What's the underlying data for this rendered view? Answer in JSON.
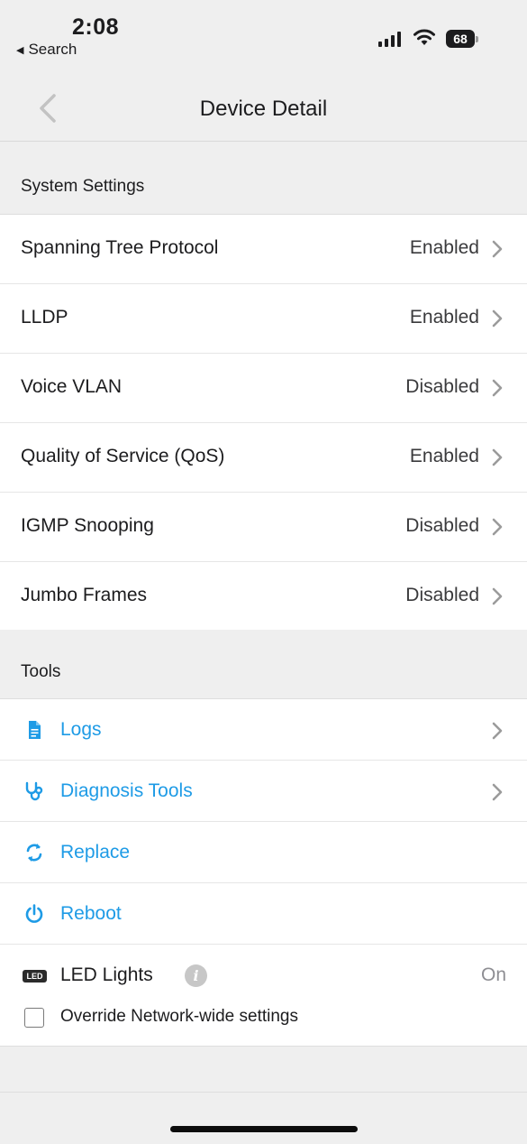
{
  "status_bar": {
    "time": "2:08",
    "back_app": "Search",
    "battery": "68"
  },
  "nav": {
    "title": "Device Detail"
  },
  "system_settings": {
    "header": "System Settings",
    "items": [
      {
        "label": "Spanning Tree Protocol",
        "value": "Enabled"
      },
      {
        "label": "LLDP",
        "value": "Enabled"
      },
      {
        "label": "Voice VLAN",
        "value": "Disabled"
      },
      {
        "label": "Quality of Service (QoS)",
        "value": "Enabled"
      },
      {
        "label": "IGMP Snooping",
        "value": "Disabled"
      },
      {
        "label": "Jumbo Frames",
        "value": "Disabled"
      }
    ]
  },
  "tools": {
    "header": "Tools",
    "items": [
      {
        "label": "Logs",
        "icon": "document-icon"
      },
      {
        "label": "Diagnosis Tools",
        "icon": "stethoscope-icon"
      },
      {
        "label": "Replace",
        "icon": "replace-icon"
      },
      {
        "label": "Reboot",
        "icon": "power-icon"
      }
    ],
    "led": {
      "icon_text": "LED",
      "label": "LED Lights",
      "info": "i",
      "value": "On",
      "override_label": "Override Network-wide settings",
      "override_checked": false
    }
  },
  "colors": {
    "accent": "#1e9be6",
    "background": "#efefef"
  }
}
